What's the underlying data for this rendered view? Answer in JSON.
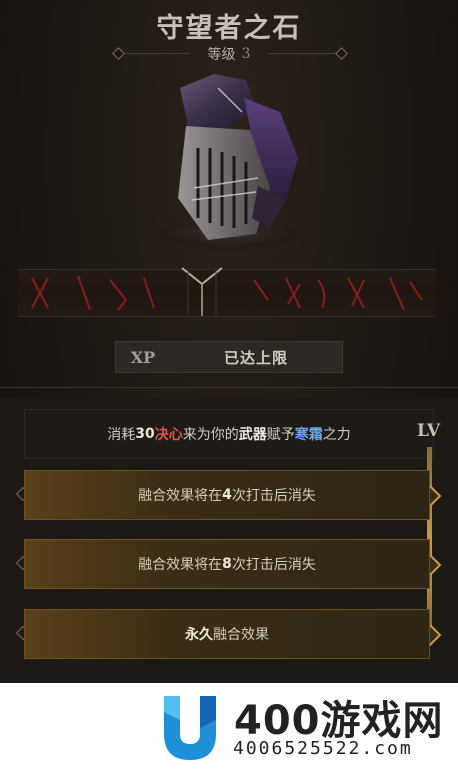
{
  "item": {
    "title": "守望者之石",
    "level_label": "等级",
    "level_value": "3"
  },
  "xp": {
    "label": "XP",
    "status": "已达上限"
  },
  "effect": {
    "prefix": "消耗",
    "amount": "30",
    "resource": "决心",
    "middle": "来为你的",
    "target": "武器",
    "middle2": "赋予",
    "element": "寒霜",
    "suffix": "之力"
  },
  "lv_label": "LV",
  "tiers": [
    {
      "before": "融合效果将在",
      "num": "4",
      "after": "次打击后消失"
    },
    {
      "before": "融合效果将在",
      "num": "8",
      "after": "次打击后消失"
    },
    {
      "before": "",
      "num": "永久",
      "after": "融合效果"
    }
  ],
  "watermark": {
    "brand": "400游戏网",
    "phone": "4006525522.com"
  },
  "colors": {
    "resource_red": "#e4564a",
    "frost_blue": "#6ea8e6",
    "tier_gold": "#c99a4c"
  }
}
